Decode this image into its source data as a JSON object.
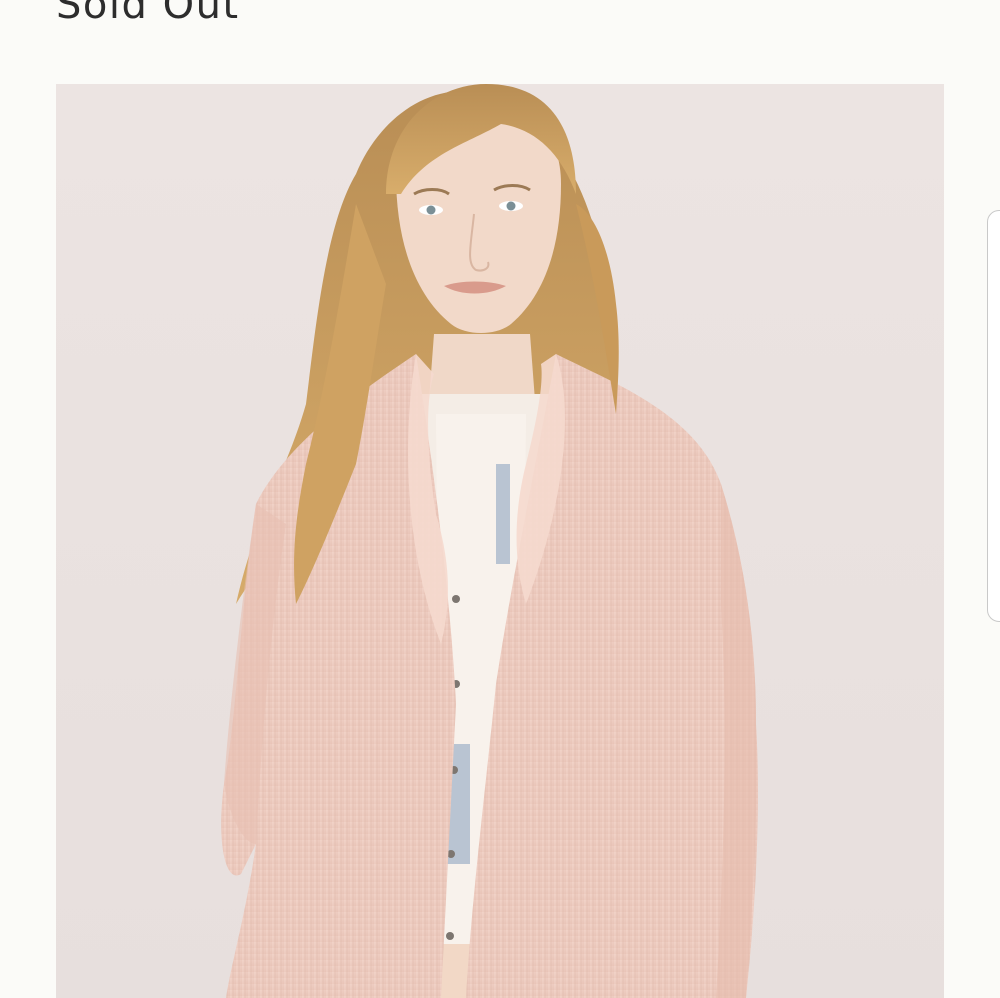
{
  "product": {
    "status_label": "Sold Out",
    "image_icon": "product-photo-woman-pink-knit-cardigan"
  },
  "colors": {
    "page_background": "#fbfbf8",
    "status_text": "#2d2d2d",
    "photo_backdrop": "#ebe3e1",
    "cardigan": "#eecdc1",
    "hair": "#c99a5a"
  }
}
